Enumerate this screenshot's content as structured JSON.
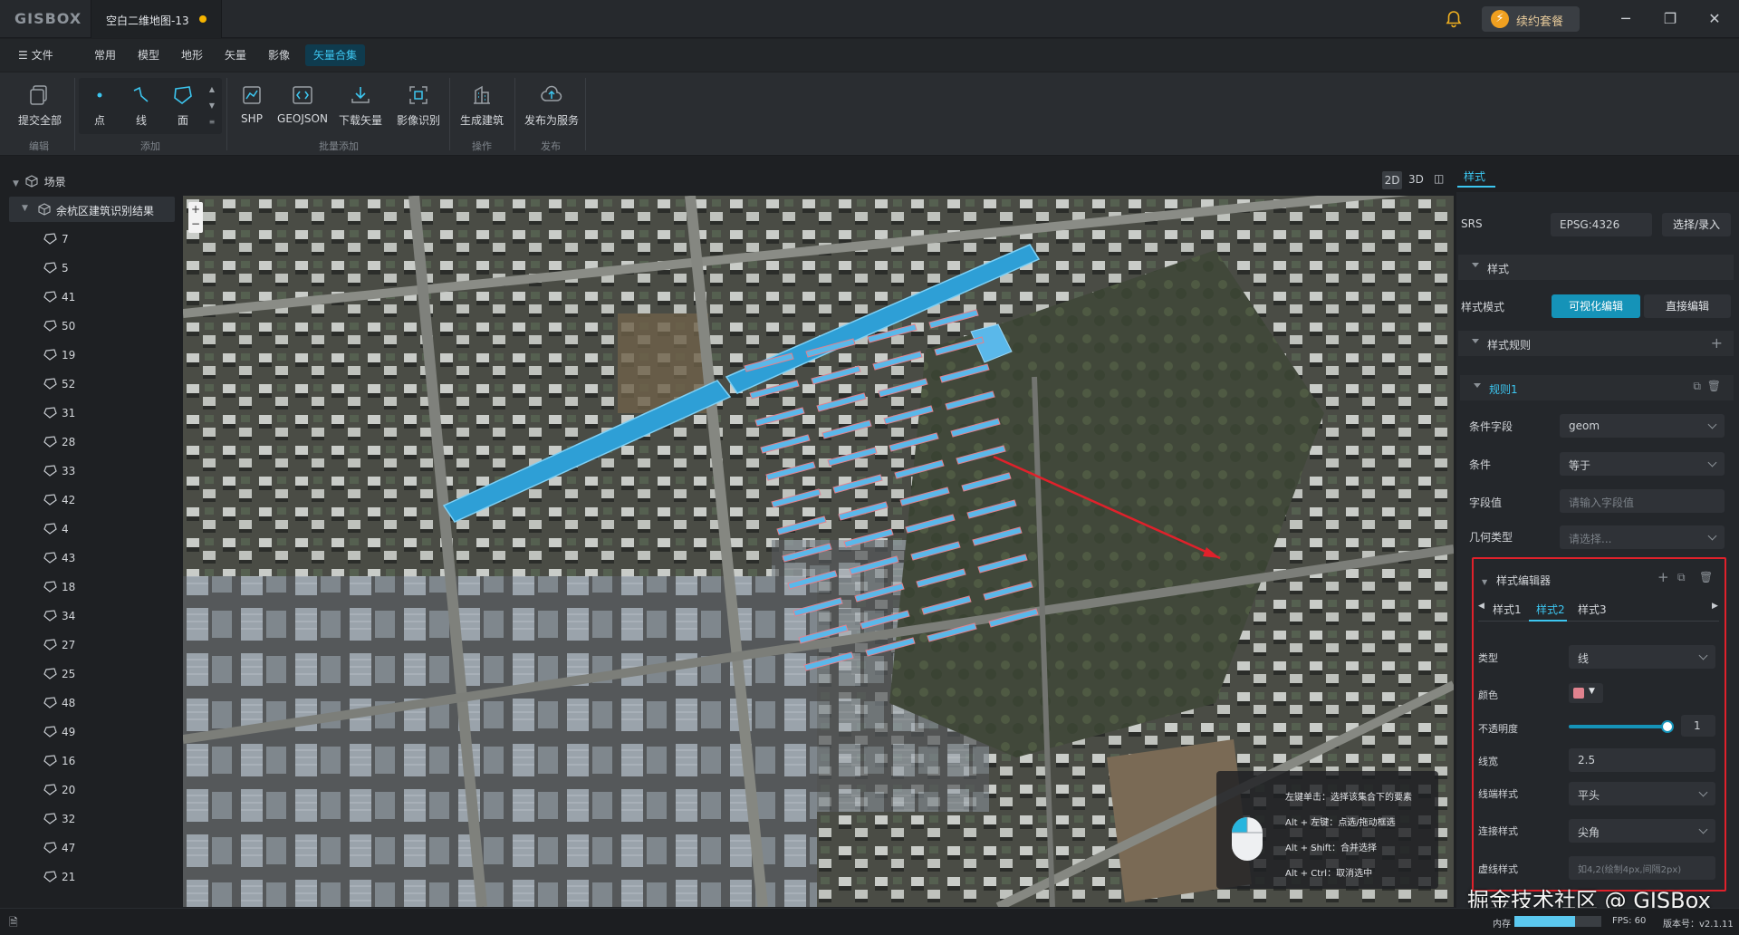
{
  "app": {
    "logo": "GISBOX",
    "document_tab": "空白二维地图-13",
    "renew_label": "续约套餐"
  },
  "menu": {
    "file": "文件",
    "items": [
      "常用",
      "模型",
      "地形",
      "矢量",
      "影像"
    ],
    "active": "矢量合集"
  },
  "toolbar": {
    "edit": {
      "submit_all": "提交全部",
      "caption": "编辑"
    },
    "add": {
      "point": "点",
      "line": "线",
      "polygon": "面",
      "caption": "添加"
    },
    "batch": {
      "shp": "SHP",
      "geojson": "GEOJSON",
      "download": "下载矢量",
      "recognize": "影像识别",
      "caption": "批量添加"
    },
    "operation": {
      "generate": "生成建筑",
      "caption": "操作"
    },
    "publish": {
      "publish": "发布为服务",
      "caption": "发布"
    }
  },
  "tree": {
    "scene": "场景",
    "root": "余杭区建筑识别结果",
    "items": [
      "7",
      "5",
      "41",
      "50",
      "19",
      "52",
      "31",
      "28",
      "33",
      "42",
      "4",
      "43",
      "18",
      "34",
      "27",
      "25",
      "48",
      "49",
      "16",
      "20",
      "32",
      "47",
      "21"
    ]
  },
  "view": {
    "mode_2d": "2D",
    "mode_3d": "3D",
    "style_tab": "样式"
  },
  "right_panel": {
    "srs_label": "SRS",
    "srs_value": "EPSG:4326",
    "srs_button": "选择/录入",
    "style_section": "样式",
    "style_mode_label": "样式模式",
    "style_mode_visual": "可视化编辑",
    "style_mode_direct": "直接编辑",
    "rules_section": "样式规则",
    "rule1": "规则1",
    "condition_field_label": "条件字段",
    "condition_field_value": "geom",
    "condition_label": "条件",
    "condition_value": "等于",
    "field_value_label": "字段值",
    "field_value_placeholder": "请输入字段值",
    "geometry_type_label": "几何类型",
    "geometry_type_placeholder": "请选择...",
    "style_editor": "样式编辑器",
    "style_tabs": [
      "样式1",
      "样式2",
      "样式3"
    ],
    "active_style_tab": "样式2",
    "type_label": "类型",
    "type_value": "线",
    "color_label": "颜色",
    "color_value": "#e0828e",
    "opacity_label": "不透明度",
    "opacity_value": "1",
    "line_width_label": "线宽",
    "line_width_value": "2.5",
    "line_cap_label": "线端样式",
    "line_cap_value": "平头",
    "line_join_label": "连接样式",
    "line_join_value": "尖角",
    "dash_label": "虚线样式",
    "dash_placeholder": "如4,2(绘制4px,间隔2px)"
  },
  "hint": {
    "line1": "左键单击：选择该集合下的要素",
    "line2": "Alt + 左键：点选/拖动框选",
    "line3": "Alt + Shift：合并选择",
    "line4": "Alt + Ctrl：取消选中"
  },
  "status": {
    "memory_label": "内存",
    "memory_fraction": 0.7,
    "fps": "FPS: 60",
    "version": "版本号：v2.1.11"
  },
  "watermark": "掘金技术社区 @ GISBox",
  "colors": {
    "accent": "#3cc6f0",
    "primary_button": "#1593b8",
    "highlight_red": "#e0212b",
    "water_blue": "#2e9fd6"
  }
}
